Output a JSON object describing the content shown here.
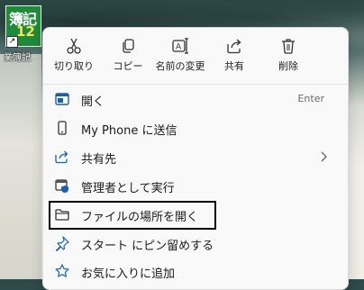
{
  "desktop": {
    "icon": {
      "tile_text": "簿記",
      "tile_number": "12",
      "label": "業簿記"
    }
  },
  "context_menu": {
    "quick_actions": [
      {
        "label": "切り取り",
        "icon": "scissors-icon"
      },
      {
        "label": "コピー",
        "icon": "copy-icon"
      },
      {
        "label": "名前の変更",
        "icon": "rename-icon"
      },
      {
        "label": "共有",
        "icon": "share-icon"
      },
      {
        "label": "削除",
        "icon": "trash-icon"
      }
    ],
    "items": [
      {
        "label": "開く",
        "shortcut": "Enter",
        "icon": "open-window-icon"
      },
      {
        "label": "My Phone に送信",
        "icon": "phone-icon"
      },
      {
        "label": "共有先",
        "icon": "share-to-icon",
        "has_submenu": true
      },
      {
        "label": "管理者として実行",
        "icon": "admin-shield-icon"
      },
      {
        "label": "ファイルの場所を開く",
        "icon": "folder-icon",
        "highlighted": true
      },
      {
        "label": "スタート にピン留めする",
        "icon": "pin-icon"
      },
      {
        "label": "お気に入りに追加",
        "icon": "star-icon"
      }
    ]
  },
  "colors": {
    "menu_bg": "#f9f9f9",
    "icon_accent": "#1a5fb4",
    "highlight_border": "#000000"
  }
}
